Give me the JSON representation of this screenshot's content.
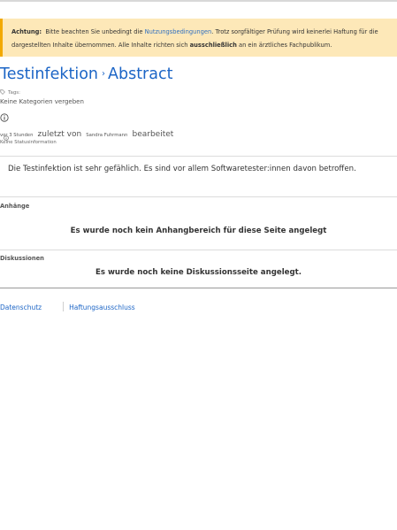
{
  "notice": {
    "label": "Achtung:",
    "text_before_link": "Bitte beachten Sie unbedingt die ",
    "link_text": "Nutzungsbedingungen",
    "text_after_link": ". Trotz sorgfältiger Prüfung wird keinerlei Haftung für die dargestellten Inhalte übernommen. Alle Inhalte richten sich ",
    "bold_text": "ausschließlich",
    "text_end": " an ein ärztliches Fachpublikum."
  },
  "page": {
    "title": "Testinfektion",
    "separator": "›",
    "subtitle": "Abstract"
  },
  "meta": {
    "tags_label": "Tags:",
    "no_categories": "Keine Kategorien vergeben",
    "time_ago": "vor 3 Stunden",
    "last_by": "zuletzt von",
    "author": "Sandra Fuhrmann",
    "edited": "bearbeitet",
    "status_info": "Keine Statusinformation"
  },
  "content": {
    "body": "Die Testinfektion ist sehr gefählich. Es sind vor allem Softwaretester:innen davon betroffen."
  },
  "attachments": {
    "label": "Anhänge",
    "message": "Es wurde noch kein Anhangbereich für diese Seite angelegt"
  },
  "discussions": {
    "label": "Diskussionen",
    "message": "Es wurde noch keine Diskussionsseite angelegt."
  },
  "footer": {
    "privacy": "Datenschutz",
    "disclaimer": "Haftungsausschluss"
  },
  "colors": {
    "link": "#1c65c6",
    "notice_bg": "#fde8b8",
    "notice_border": "#f2a900"
  },
  "icons": {
    "tag": "tag-icon",
    "info": "info-icon",
    "status": "info-small-icon"
  }
}
